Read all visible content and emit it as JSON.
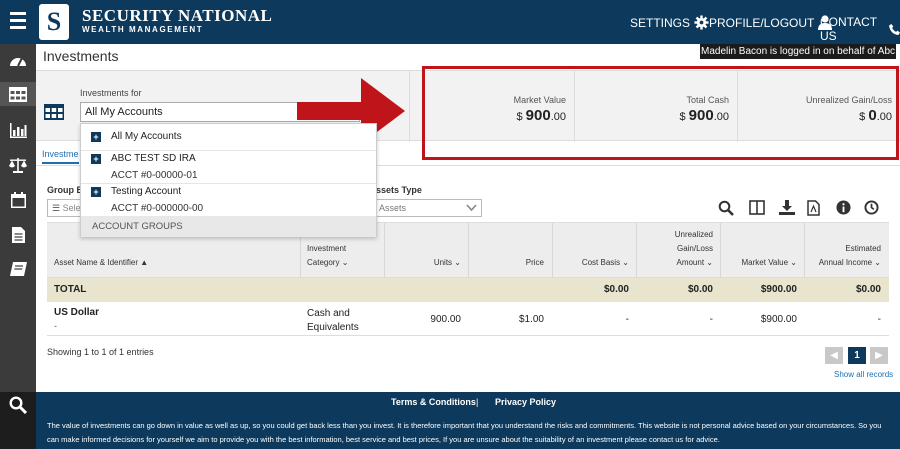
{
  "brand": {
    "logo_letter": "S",
    "name": "SECURITY NATIONAL",
    "sub": "WEALTH MANAGEMENT"
  },
  "nav": {
    "settings": "SETTINGS",
    "profile": "PROFILE/LOGOUT",
    "contact": "CONTACT US"
  },
  "banner": "Madelin Bacon is logged in on behalf of Abc Test",
  "page_title": "Investments",
  "investments_for": {
    "label": "Investments for",
    "value": "All My Accounts"
  },
  "cards": [
    {
      "label": "Market Value",
      "currency": "$",
      "whole": "900",
      "cents": ".00"
    },
    {
      "label": "Total Cash",
      "currency": "$",
      "whole": "900",
      "cents": ".00"
    },
    {
      "label": "Unrealized Gain/Loss",
      "currency": "$",
      "whole": "0",
      "cents": ".00"
    }
  ],
  "tab": "Investme",
  "dropdown": {
    "items": [
      {
        "label": "All My Accounts",
        "sub": ""
      },
      {
        "label": "ABC TEST SD IRA",
        "sub": "ACCT #0-00000-01"
      },
      {
        "label": "Testing Account",
        "sub": "ACCT #0-000000-00"
      }
    ],
    "groups": "ACCOUNT GROUPS"
  },
  "group_by": {
    "label": "Group By",
    "placeholder": "Sele"
  },
  "assets_type": {
    "label": "ssets Type",
    "value": "ll Assets"
  },
  "table": {
    "headers": {
      "asset": "Asset Name & Identifier",
      "category": [
        "Investment",
        "Category"
      ],
      "units": "Units",
      "price": "Price",
      "cost": "Cost Basis",
      "gain": [
        "Unrealized",
        "Gain/Loss",
        "Amount"
      ],
      "mv": "Market Value",
      "income": [
        "Estimated",
        "Annual Income"
      ]
    },
    "total": {
      "label": "TOTAL",
      "cost": "$0.00",
      "gain": "$0.00",
      "mv": "$900.00",
      "income": "$0.00"
    },
    "rows": [
      {
        "name": "US Dollar",
        "id": "-",
        "category": [
          "Cash and",
          "Equivalents"
        ],
        "units": "900.00",
        "price": "$1.00",
        "cost": "-",
        "gain": "-",
        "mv": "$900.00",
        "income": "-"
      }
    ]
  },
  "showing": "Showing 1 to 1 of 1 entries",
  "pager": {
    "current": "1"
  },
  "show_all": "Show all records",
  "footer": {
    "terms": "Terms & Conditions",
    "divider": "|",
    "privacy": "Privacy Policy",
    "disclaimer": "The value of investments can go down in value as well as up, so you could get back less than you invest. It is therefore important that you understand the risks and commitments. This website is not personal advice based on your circumstances. So you can make informed decisions for yourself we aim to provide you with the best information, best service and best prices, If you are unsure about the suitability of an investment please contact us for advice."
  },
  "colors": {
    "navy": "#0d3a5c",
    "annotation_red": "#c0141b",
    "link_blue": "#1f6fb0",
    "total_row": "#e8e4cd"
  }
}
